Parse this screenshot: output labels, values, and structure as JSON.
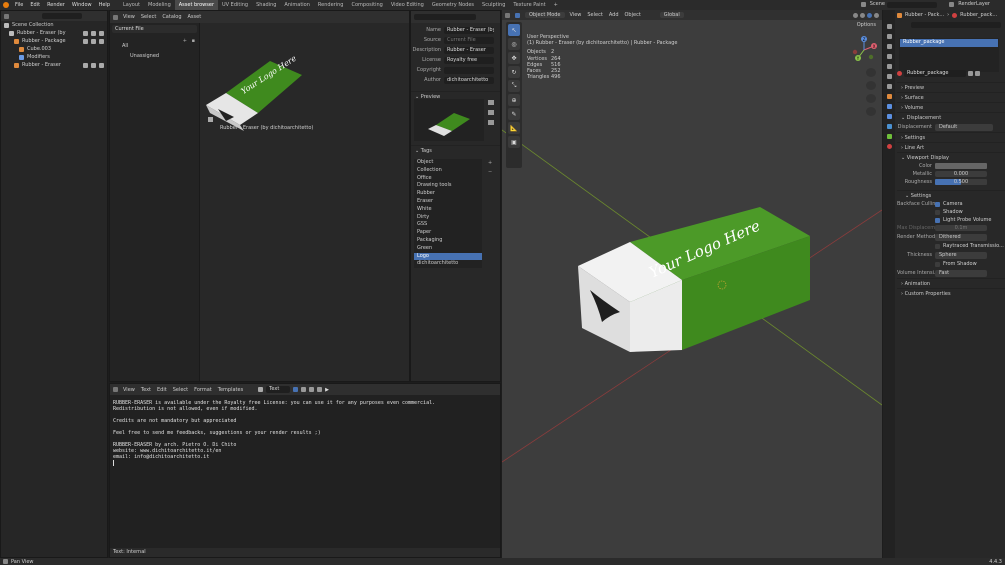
{
  "menu": [
    "File",
    "Edit",
    "Render",
    "Window",
    "Help"
  ],
  "workspaces": [
    {
      "label": "Layout",
      "active": false
    },
    {
      "label": "Modeling",
      "active": false
    },
    {
      "label": "Asset browser",
      "active": true
    },
    {
      "label": "UV Editing",
      "active": false
    },
    {
      "label": "Shading",
      "active": false
    },
    {
      "label": "Animation",
      "active": false
    },
    {
      "label": "Rendering",
      "active": false
    },
    {
      "label": "Compositing",
      "active": false
    },
    {
      "label": "Video Editing",
      "active": false
    },
    {
      "label": "Geometry Nodes",
      "active": false
    },
    {
      "label": "Sculpting",
      "active": false
    },
    {
      "label": "Texture Paint",
      "active": false
    },
    {
      "label": "+",
      "active": false
    }
  ],
  "top_right": {
    "scene_label": "Scene",
    "view_layer_label": "RenderLayer"
  },
  "outliner": {
    "header_label": "Scene Collection",
    "items": [
      {
        "label": "Rubber - Eraser (by",
        "depth": 1,
        "color": "#bdbdbd"
      },
      {
        "label": "Rubber - Package",
        "depth": 2,
        "color": "#e08a3c"
      },
      {
        "label": "Cube.003",
        "depth": 3,
        "color": "#e08a3c"
      },
      {
        "label": "Modifiers",
        "depth": 3,
        "color": "#6b9be6"
      },
      {
        "label": "Rubber - Eraser",
        "depth": 2,
        "color": "#e08a3c"
      }
    ]
  },
  "asset_browser": {
    "menus": [
      "View",
      "Select",
      "Catalog",
      "Asset"
    ],
    "current_file_label": "Current File",
    "catalogs": [
      "All",
      "Unassigned"
    ],
    "asset_name": "Rubber - Eraser (by dichitoarchitetto)",
    "thumb_text": "Your Logo Here"
  },
  "asset_metadata": {
    "rows": [
      {
        "label": "Name",
        "value": "Rubber - Eraser (by"
      },
      {
        "label": "Source",
        "value": "Current File"
      },
      {
        "label": "Description",
        "value": "Rubber - Eraser"
      },
      {
        "label": "License",
        "value": "Royalty free"
      },
      {
        "label": "Copyright",
        "value": ""
      },
      {
        "label": "Author",
        "value": "dichitoarchitetto"
      }
    ],
    "preview_label": "Preview",
    "tags_label": "Tags",
    "tags": [
      "Object",
      "Collection",
      "Office",
      "Drawing tools",
      "Rubber",
      "Eraser",
      "White",
      "Dirty",
      "GSS",
      "Paper",
      "Packaging",
      "Green",
      "Logo",
      "dichitoarchitetto"
    ],
    "selected_tag": "Logo"
  },
  "text_editor": {
    "menus": [
      "View",
      "Text",
      "Edit",
      "Select",
      "Format",
      "Templates"
    ],
    "file_name": "Text",
    "lines": [
      "RUBBER-ERASER is available under the Royalty free License: you can use it for any purposes even commercial.",
      "Redistribution is not allowed, even if modified.",
      "",
      "Credits are not mandatory but appreciated",
      "",
      "Feel free to send me feedbacks, suggestions or your render results ;)",
      "",
      "RUBBER-ERASER by arch. Pietro O. Di Chito",
      "website: www.dichitoarchitetto.it/en",
      "email: info@dichitoarchitetto.it"
    ],
    "footer": "Text: Internal"
  },
  "viewport": {
    "mode": "Object Mode",
    "menus": [
      "View",
      "Select",
      "Add",
      "Object"
    ],
    "transform": "Global",
    "options_label": "Options",
    "perspective": "User Perspective",
    "context": "(1) Rubber - Eraser (by dichitoarchitetto) | Rubber - Package",
    "stats": [
      {
        "label": "Objects",
        "value": "2"
      },
      {
        "label": "Vertices",
        "value": "264"
      },
      {
        "label": "Edges",
        "value": "516"
      },
      {
        "label": "Faces",
        "value": "252"
      },
      {
        "label": "Triangles",
        "value": "496"
      }
    ],
    "eraser_text": "Your Logo Here",
    "gizmo_axes": [
      "X",
      "Y",
      "Z"
    ]
  },
  "properties": {
    "breadcrumb": "Rubber - Pack...",
    "breadcrumb2": "Rubber_pack...",
    "material_slot": "Rubber_package",
    "material_name": "Rubber_package",
    "sections": {
      "preview": "Preview",
      "surface": "Surface",
      "volume": "Volume",
      "displacement": "Displacement",
      "settings": "Settings",
      "line_art": "Line Art",
      "viewport_display": "Viewport Display",
      "animation": "Animation",
      "custom_properties": "Custom Properties",
      "settings2": "Settings"
    },
    "displacement": {
      "label": "Displacement",
      "value": "Default"
    },
    "viewport_display": {
      "color_label": "Color",
      "metallic_label": "Metallic",
      "metallic_value": "0.000",
      "roughness_label": "Roughness",
      "roughness_value": "0.500",
      "roughness_fraction": 0.5
    },
    "settings": {
      "backface_label": "Backface Culling",
      "camera": "Camera",
      "shadow": "Shadow",
      "light_probe": "Light Probe Volume",
      "max_disp_label": "Max Displacem...",
      "max_disp_value": "0.1m",
      "render_method_label": "Render Method",
      "render_method": "Dithered",
      "raytraced": "Raytraced Transmissio...",
      "thickness_label": "Thickness",
      "thickness_value": "Sphere",
      "from_shadow": "From Shadow",
      "volume_label": "Volume Intensi...",
      "volume_value": "Fast"
    }
  },
  "status_bar": {
    "left": "Pan View",
    "right": "4.4.3"
  },
  "colors": {
    "accent": "#4772b3",
    "green": "#3f8a1e",
    "panel": "#282828",
    "viewport": "#3d3d3d"
  }
}
